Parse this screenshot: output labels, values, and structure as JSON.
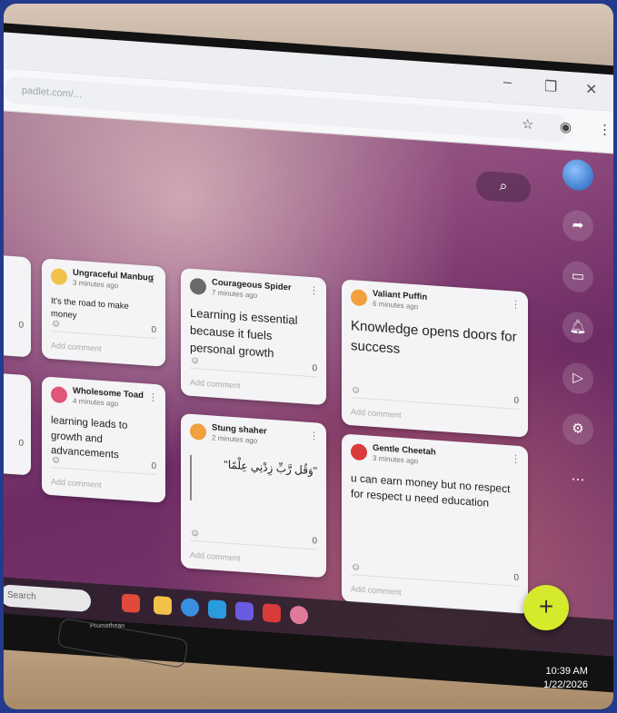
{
  "browser": {
    "url_text": "padlet.com/...",
    "titlebar_controls": [
      "–",
      "❐",
      "✕"
    ],
    "bookmark_icon": "star-icon",
    "profile_icon": "profile-icon",
    "menu_icon": "kebab-menu-icon"
  },
  "padlet": {
    "search_icon": "search-icon",
    "sidebar": [
      "globe-icon",
      "share-icon",
      "slideshow-icon",
      "bell-icon",
      "play-icon",
      "gear-icon",
      "more-icon"
    ],
    "cards": [
      {
        "author": "Ungraceful Manbug",
        "time": "3 minutes ago",
        "text": "It's the road to make money",
        "comments": "0",
        "add": "Add comment",
        "avatar_color": "#f0c24a"
      },
      {
        "author": "Courageous Spider",
        "time": "7 minutes ago",
        "text": "Learning is essential because it fuels personal growth",
        "comments": "0",
        "add": "Add comment",
        "avatar_color": "#6a6a6a"
      },
      {
        "author": "Valiant Puffin",
        "time": "6 minutes ago",
        "text": "Knowledge opens doors for success",
        "comments": "0",
        "add": "Add comment",
        "avatar_color": "#f0a03c"
      },
      {
        "author": "Wholesome Toad",
        "time": "4 minutes ago",
        "text": "learning leads to growth and advancements",
        "comments": "0",
        "add": "Add comment",
        "avatar_color": "#e0557a"
      },
      {
        "author": "Stung shaher",
        "time": "2 minutes ago",
        "text": "\"وَقُل رَّبِّ زِدْنِي عِلْمًا\"",
        "comments": "0",
        "add": "Add comment",
        "avatar_color": "#f0a03c"
      },
      {
        "author": "Gentle Cheetah",
        "time": "3 minutes ago",
        "text": "u can earn money but no respect\nfor respect u need education",
        "comments": "0",
        "add": "Add comment",
        "avatar_color": "#d93a3a"
      }
    ],
    "left_cards_comment": [
      "0",
      "0"
    ],
    "fab_label": "+"
  },
  "taskbar": {
    "search_placeholder": "Search",
    "icons": [
      "edge-icon",
      "folder-icon",
      "chrome-icon",
      "explorer-icon",
      "teams-icon",
      "acrobat-icon",
      "app-icon"
    ]
  },
  "clock": {
    "time": "10:39 AM",
    "date": "1/22/2026"
  },
  "bezel_brand": "Promethean"
}
